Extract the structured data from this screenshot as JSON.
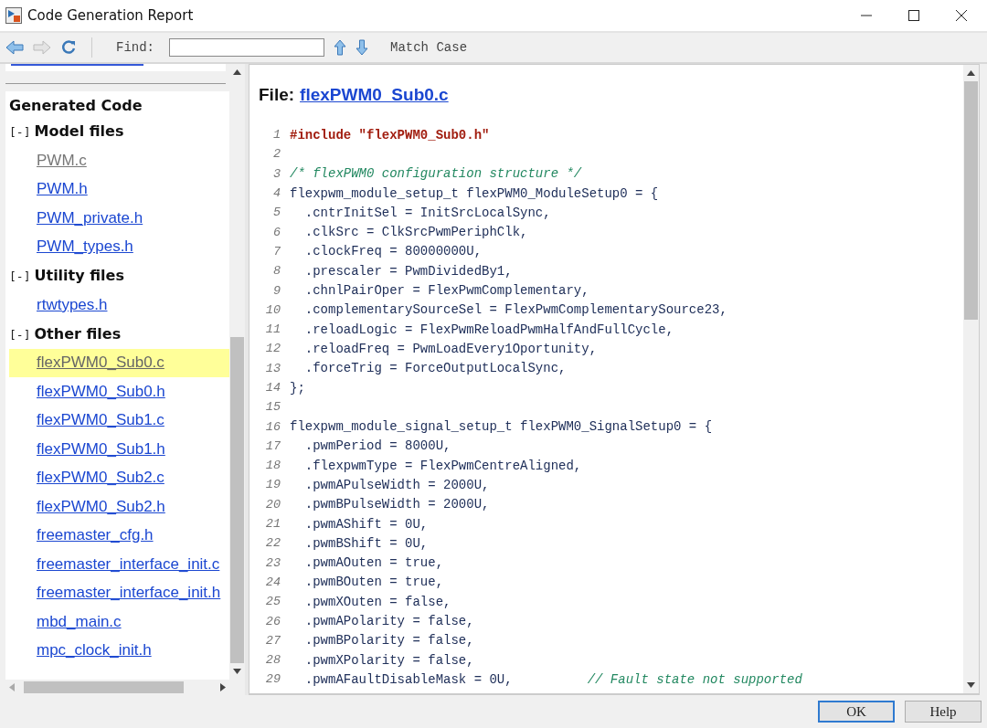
{
  "window": {
    "title": "Code Generation Report"
  },
  "toolbar": {
    "find_label": "Find:",
    "match_case": "Match Case"
  },
  "sidebar": {
    "heading": "Generated Code",
    "groups": [
      {
        "toggle": "[-]",
        "title": "Model files",
        "items": [
          {
            "label": "PWM.c",
            "visited": true,
            "selected": false
          },
          {
            "label": "PWM.h",
            "visited": false,
            "selected": false
          },
          {
            "label": "PWM_private.h",
            "visited": false,
            "selected": false
          },
          {
            "label": "PWM_types.h",
            "visited": false,
            "selected": false
          }
        ]
      },
      {
        "toggle": "[-]",
        "title": "Utility files",
        "items": [
          {
            "label": "rtwtypes.h",
            "visited": false,
            "selected": false
          }
        ]
      },
      {
        "toggle": "[-]",
        "title": "Other files",
        "items": [
          {
            "label": "flexPWM0_Sub0.c",
            "visited": true,
            "selected": true
          },
          {
            "label": "flexPWM0_Sub0.h",
            "visited": false,
            "selected": false
          },
          {
            "label": "flexPWM0_Sub1.c",
            "visited": false,
            "selected": false
          },
          {
            "label": "flexPWM0_Sub1.h",
            "visited": false,
            "selected": false
          },
          {
            "label": "flexPWM0_Sub2.c",
            "visited": false,
            "selected": false
          },
          {
            "label": "flexPWM0_Sub2.h",
            "visited": false,
            "selected": false
          },
          {
            "label": "freemaster_cfg.h",
            "visited": false,
            "selected": false
          },
          {
            "label": "freemaster_interface_init.c",
            "visited": false,
            "selected": false
          },
          {
            "label": "freemaster_interface_init.h",
            "visited": false,
            "selected": false
          },
          {
            "label": "mbd_main.c",
            "visited": false,
            "selected": false
          },
          {
            "label": "mpc_clock_init.h",
            "visited": false,
            "selected": false
          }
        ]
      }
    ]
  },
  "file": {
    "label": "File:",
    "name": "flexPWM0_Sub0.c"
  },
  "code": [
    {
      "num": "1",
      "parts": [
        {
          "kind": "preproc",
          "text": "#include \"flexPWM0_Sub0.h\""
        }
      ]
    },
    {
      "num": "2"
    },
    {
      "num": "3",
      "parts": [
        {
          "kind": "comment",
          "text": "/* flexPWM0 configuration structure */"
        }
      ]
    },
    {
      "num": "4",
      "parts": [
        {
          "kind": "code",
          "text": "flexpwm_module_setup_t flexPWM0_ModuleSetup0 = {"
        }
      ]
    },
    {
      "num": "5",
      "parts": [
        {
          "kind": "code",
          "text": "  .cntrInitSel = InitSrcLocalSync,"
        }
      ]
    },
    {
      "num": "6",
      "parts": [
        {
          "kind": "code",
          "text": "  .clkSrc = ClkSrcPwmPeriphClk,"
        }
      ]
    },
    {
      "num": "7",
      "parts": [
        {
          "kind": "code",
          "text": "  .clockFreq = 80000000U,"
        }
      ]
    },
    {
      "num": "8",
      "parts": [
        {
          "kind": "code",
          "text": "  .prescaler = PwmDividedBy1,"
        }
      ]
    },
    {
      "num": "9",
      "parts": [
        {
          "kind": "code",
          "text": "  .chnlPairOper = FlexPwmComplementary,"
        }
      ]
    },
    {
      "num": "10",
      "parts": [
        {
          "kind": "code",
          "text": "  .complementarySourceSel = FlexPwmComplementarySource23,"
        }
      ]
    },
    {
      "num": "11",
      "parts": [
        {
          "kind": "code",
          "text": "  .reloadLogic = FlexPwmReloadPwmHalfAndFullCycle,"
        }
      ]
    },
    {
      "num": "12",
      "parts": [
        {
          "kind": "code",
          "text": "  .reloadFreq = PwmLoadEvery1Oportunity,"
        }
      ]
    },
    {
      "num": "13",
      "parts": [
        {
          "kind": "code",
          "text": "  .forceTrig = ForceOutputLocalSync,"
        }
      ]
    },
    {
      "num": "14",
      "parts": [
        {
          "kind": "code",
          "text": "};"
        }
      ]
    },
    {
      "num": "15"
    },
    {
      "num": "16",
      "parts": [
        {
          "kind": "code",
          "text": "flexpwm_module_signal_setup_t flexPWM0_SignalSetup0 = {"
        }
      ]
    },
    {
      "num": "17",
      "parts": [
        {
          "kind": "code",
          "text": "  .pwmPeriod = 8000U,"
        }
      ]
    },
    {
      "num": "18",
      "parts": [
        {
          "kind": "code",
          "text": "  .flexpwmType = FlexPwmCentreAligned,"
        }
      ]
    },
    {
      "num": "19",
      "parts": [
        {
          "kind": "code",
          "text": "  .pwmAPulseWidth = 2000U,"
        }
      ]
    },
    {
      "num": "20",
      "parts": [
        {
          "kind": "code",
          "text": "  .pwmBPulseWidth = 2000U,"
        }
      ]
    },
    {
      "num": "21",
      "parts": [
        {
          "kind": "code",
          "text": "  .pwmAShift = 0U,"
        }
      ]
    },
    {
      "num": "22",
      "parts": [
        {
          "kind": "code",
          "text": "  .pwmBShift = 0U,"
        }
      ]
    },
    {
      "num": "23",
      "parts": [
        {
          "kind": "code",
          "text": "  .pwmAOuten = true,"
        }
      ]
    },
    {
      "num": "24",
      "parts": [
        {
          "kind": "code",
          "text": "  .pwmBOuten = true,"
        }
      ]
    },
    {
      "num": "25",
      "parts": [
        {
          "kind": "code",
          "text": "  .pwmXOuten = false,"
        }
      ]
    },
    {
      "num": "26",
      "parts": [
        {
          "kind": "code",
          "text": "  .pwmAPolarity = false,"
        }
      ]
    },
    {
      "num": "27",
      "parts": [
        {
          "kind": "code",
          "text": "  .pwmBPolarity = false,"
        }
      ]
    },
    {
      "num": "28",
      "parts": [
        {
          "kind": "code",
          "text": "  .pwmXPolarity = false,"
        }
      ]
    },
    {
      "num": "29",
      "parts": [
        {
          "kind": "code",
          "text": "  .pwmAFaultDisableMask = 0U,"
        },
        {
          "kind": "comment",
          "text": "// Fault state not supported"
        }
      ]
    }
  ],
  "buttons": [
    {
      "label": "OK",
      "default": true
    },
    {
      "label": "Help",
      "default": false
    }
  ]
}
